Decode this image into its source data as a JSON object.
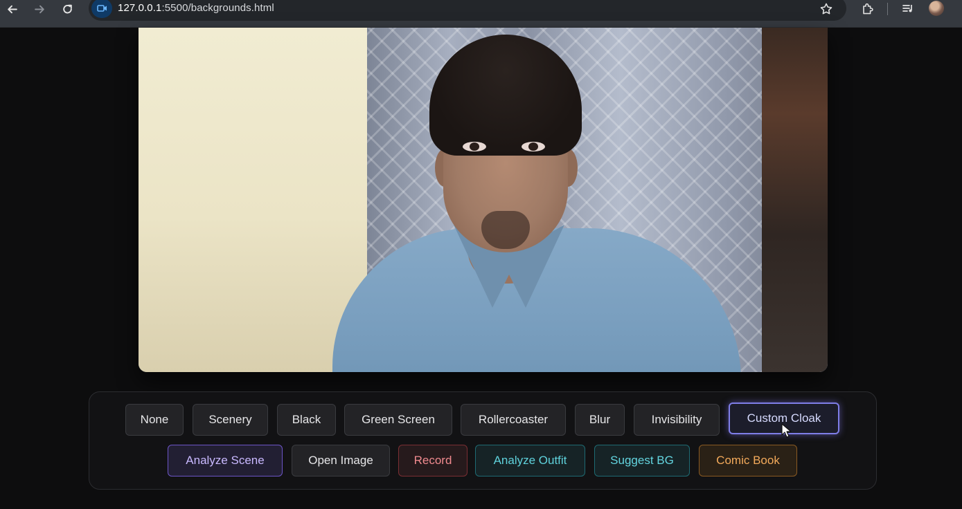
{
  "browser": {
    "url_host": "127.0.0.1",
    "url_rest": ":5500/backgrounds.html",
    "icons": [
      "back-arrow-icon",
      "forward-arrow-icon",
      "reload-icon",
      "video-camera-icon",
      "star-icon",
      "extensions-icon",
      "media-control-icon",
      "profile-avatar"
    ]
  },
  "video": {
    "description_icon": "webcam-feed"
  },
  "controls": {
    "row1": [
      {
        "label": "None"
      },
      {
        "label": "Scenery"
      },
      {
        "label": "Black"
      },
      {
        "label": "Green Screen"
      },
      {
        "label": "Rollercoaster"
      },
      {
        "label": "Blur"
      },
      {
        "label": "Invisibility"
      },
      {
        "label": "Custom Cloak",
        "active": true
      }
    ],
    "row2": [
      {
        "label": "Analyze Scene",
        "accent": "#6d55c8"
      },
      {
        "label": "Open Image"
      },
      {
        "label": "Record",
        "accent": "#f08a8f"
      },
      {
        "label": "Analyze Outfit",
        "accent": "#5fd2dc"
      },
      {
        "label": "Suggest BG",
        "accent": "#63d4df"
      },
      {
        "label": "Comic Book",
        "accent": "#f3aa5b"
      }
    ]
  }
}
